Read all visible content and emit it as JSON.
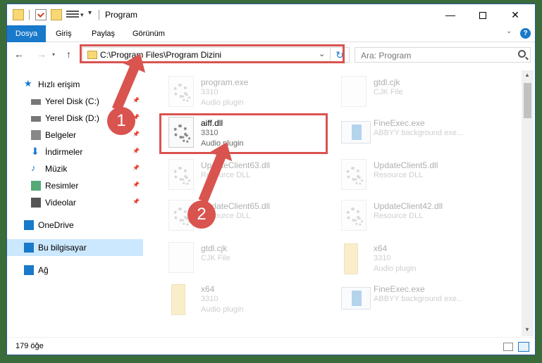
{
  "window": {
    "title": "Program"
  },
  "ribbon": {
    "tabs": [
      "Dosya",
      "Giriş",
      "Paylaş",
      "Görünüm"
    ],
    "help": "?"
  },
  "nav": {
    "address": "C:\\Program Files\\Program Dizini",
    "search_placeholder": "Ara: Program"
  },
  "sidebar": {
    "items": [
      {
        "label": "Hızlı erişim",
        "icon": "star-icon",
        "pinned": false
      },
      {
        "label": "Yerel Disk (C:)",
        "icon": "drive-icon",
        "pinned": true
      },
      {
        "label": "Yerel Disk (D:)",
        "icon": "drive-icon",
        "pinned": true
      },
      {
        "label": "Belgeler",
        "icon": "documents-icon",
        "pinned": true
      },
      {
        "label": "İndirmeler",
        "icon": "download-icon",
        "pinned": true
      },
      {
        "label": "Müzik",
        "icon": "music-icon",
        "pinned": true
      },
      {
        "label": "Resimler",
        "icon": "pictures-icon",
        "pinned": true
      },
      {
        "label": "Videolar",
        "icon": "videos-icon",
        "pinned": true
      },
      {
        "label": "OneDrive",
        "icon": "cloud-icon",
        "pinned": false
      },
      {
        "label": "Bu bilgisayar",
        "icon": "computer-icon",
        "pinned": false,
        "selected": true
      },
      {
        "label": "Ağ",
        "icon": "network-icon",
        "pinned": false
      }
    ]
  },
  "files": [
    {
      "name": "program.exe",
      "l2": "3310",
      "l3": "Audio plugin",
      "icon": "exe",
      "faded": true
    },
    {
      "name": "gtdl.cjk",
      "l2": "CJK File",
      "l3": "",
      "icon": "blank",
      "faded": true
    },
    {
      "name": "aiff.dll",
      "l2": "3310",
      "l3": "Audio plugin",
      "icon": "gear",
      "faded": false
    },
    {
      "name": "FineExec.exe",
      "l2": "ABBYY background exe...",
      "l3": "",
      "icon": "blue",
      "faded": true
    },
    {
      "name": "UpdateClient63.dll",
      "l2": "Resource DLL",
      "l3": "",
      "icon": "gear",
      "faded": true
    },
    {
      "name": "UpdateClient5.dll",
      "l2": "Resource DLL",
      "l3": "",
      "icon": "gear",
      "faded": true
    },
    {
      "name": "UpdateClient65.dll",
      "l2": "Resource DLL",
      "l3": "",
      "icon": "gear",
      "faded": true
    },
    {
      "name": "UpdateClient42.dll",
      "l2": "Resource DLL",
      "l3": "",
      "icon": "gear",
      "faded": true
    },
    {
      "name": "gtdl.cjk",
      "l2": "CJK File",
      "l3": "",
      "icon": "blank",
      "faded": true
    },
    {
      "name": "x64",
      "l2": "3310",
      "l3": "Audio plugin",
      "icon": "folder",
      "faded": true
    },
    {
      "name": "x64",
      "l2": "3310",
      "l3": "Audio plugin",
      "icon": "folder",
      "faded": true
    },
    {
      "name": "FineExec.exe",
      "l2": "ABBYY background exe...",
      "l3": "",
      "icon": "blue",
      "faded": true
    }
  ],
  "annotations": {
    "badge1": "1",
    "badge2": "2"
  },
  "status": {
    "count": "179 öğe"
  },
  "colors": {
    "accent": "#1979ca",
    "highlight": "#d9534f"
  }
}
